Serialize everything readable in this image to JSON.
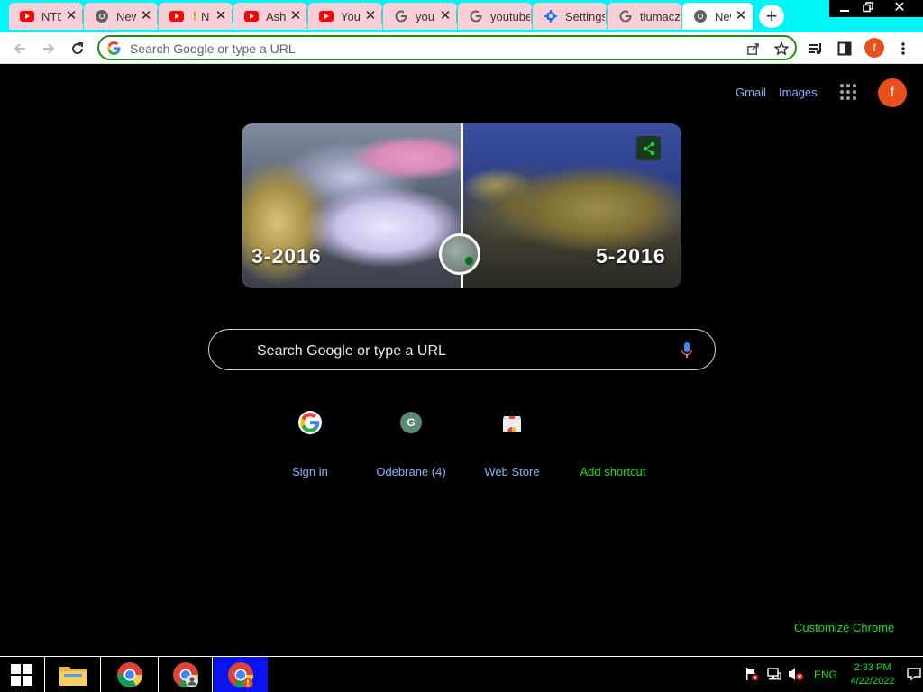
{
  "tabs": [
    {
      "title": "NTD",
      "favicon": "youtube-icon"
    },
    {
      "title": "New",
      "favicon": "chrome-icon"
    },
    {
      "title": "N",
      "favicon": "youtube-icon"
    },
    {
      "title": "Ash",
      "favicon": "youtube-icon"
    },
    {
      "title": "You",
      "favicon": "youtube-icon"
    },
    {
      "title": "you",
      "favicon": "google-icon"
    },
    {
      "title": "youtube",
      "favicon": "google-icon"
    },
    {
      "title": "Settings",
      "favicon": "settings-gear-icon"
    },
    {
      "title": "tłumacz",
      "favicon": "google-icon"
    },
    {
      "title": "New",
      "favicon": "chrome-icon",
      "active": true
    }
  ],
  "toolbar": {
    "omnibox_placeholder": "Search Google or type a URL",
    "profile_initial": "f"
  },
  "ntp": {
    "gmail_label": "Gmail",
    "images_label": "Images",
    "profile_initial": "f",
    "doodle": {
      "left_date": "3-2016",
      "right_date": "5-2016"
    },
    "search_placeholder": "Search Google or type a URL",
    "shortcuts": [
      {
        "label": "Sign in",
        "icon": "google-g-icon"
      },
      {
        "label": "Odebrane (4)",
        "icon": "letter-g-icon",
        "icon_text": "G"
      },
      {
        "label": "Web Store",
        "icon": "web-store-icon"
      },
      {
        "label": "Add shortcut",
        "icon": "add-icon"
      }
    ],
    "customize_label": "Customize Chrome"
  },
  "taskbar": {
    "language": "ENG",
    "time": "2:33 PM",
    "date": "4/22/2022"
  },
  "colors": {
    "tab_strip": "#00f5f5",
    "tab_bg": "#f9cfd8",
    "link_blue": "#8ab4f8",
    "accent_green": "#1be21b",
    "avatar_orange": "#e8501d",
    "taskbar_active": "#0a14f0"
  }
}
